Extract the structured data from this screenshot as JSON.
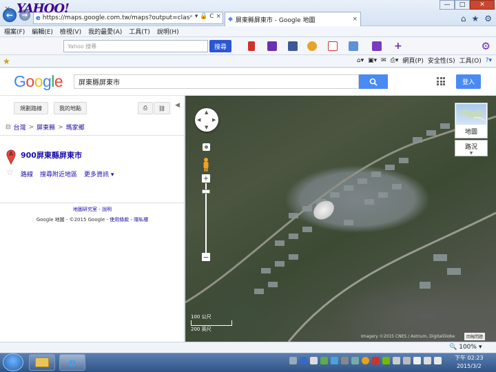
{
  "browser": {
    "url": "https://maps.google.com.tw/maps?output=class",
    "tab_title": "屏東縣屏東市 - Google 地圖",
    "menu": [
      "檔案(F)",
      "編輯(E)",
      "檢視(V)",
      "我的最愛(A)",
      "工具(T)",
      "說明(H)"
    ]
  },
  "yahoo_toolbar": {
    "logo": "YAHOO!",
    "search_placeholder": "Yahoo 搜尋",
    "search_button": "搜尋"
  },
  "command_bar": {
    "page": "網頁(P)",
    "safety": "安全性(S)",
    "tools": "工具(O)"
  },
  "google": {
    "logo": "Google",
    "search_value": "屏東縣屏東市",
    "signin": "登入"
  },
  "left_panel": {
    "btn_directions": "規劃路線",
    "btn_mymaps": "我的地點",
    "breadcrumbs": [
      "台灣",
      "屏東縣",
      "瑪家鄉"
    ],
    "marker_letter": "A",
    "place_name": "900屏東縣屏東市",
    "links": [
      "路線",
      "搜尋附近地區",
      "更多資訊"
    ],
    "footer_line1": "地圖研究室 - 說明",
    "footer_prefix": "Google 地圖 - ©2015 Google - ",
    "footer_terms": "使用條款",
    "footer_privacy": "隱私權"
  },
  "map": {
    "map_type_label": "地圖",
    "traffic_label": "路況",
    "scale_top": "100 公尺",
    "scale_bottom": "200 英尺",
    "copyright": "Imagery ©2015 CNES / Astrium, DigitalGlobe",
    "report": "回報問題"
  },
  "status": {
    "zoom": "100%"
  },
  "taskbar": {
    "time": "下午 02:23",
    "date": "2015/3/2"
  }
}
